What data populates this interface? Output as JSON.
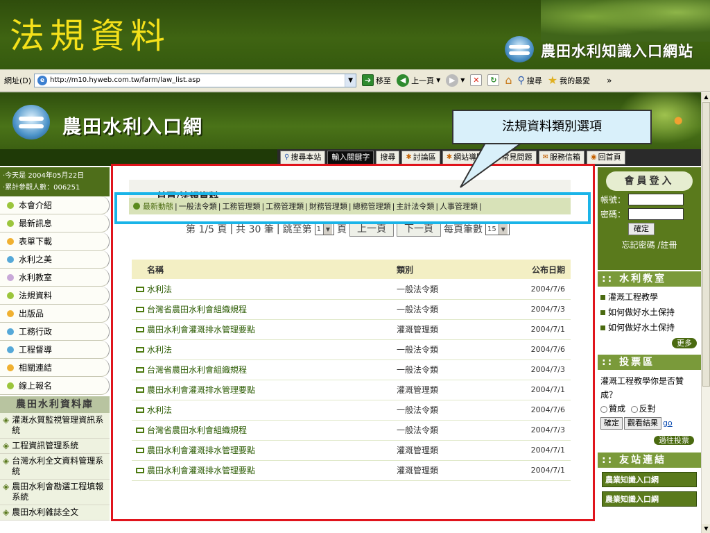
{
  "slide_title": "法規資料",
  "header_brand": "農田水利知識入口網站",
  "address": {
    "label": "網址(D)",
    "url": "http://m10.hyweb.com.tw/farm/law_list.asp",
    "go_label": "移至",
    "back_label": "上一頁",
    "search_label": "搜尋",
    "favorites_label": "我的最愛",
    "more": "»"
  },
  "site": {
    "name": "農田水利入口網"
  },
  "nav": [
    "搜尋本站",
    "輸入關鍵字",
    "搜尋",
    "討論區",
    "網站導覽",
    "常見問題",
    "服務信箱",
    "回首頁"
  ],
  "left": {
    "today": "‧今天是 2004年05月22日",
    "visitors": "‧累計參觀人數：006251",
    "menu": [
      {
        "label": "本會介紹",
        "color": "#9bc53c"
      },
      {
        "label": "最新訊息",
        "color": "#9bc53c"
      },
      {
        "label": "表單下載",
        "color": "#f0b030"
      },
      {
        "label": "水利之美",
        "color": "#55a8d8"
      },
      {
        "label": "水利教室",
        "color": "#c8a8d8"
      },
      {
        "label": "法規資料",
        "color": "#9bc53c"
      },
      {
        "label": "出版品",
        "color": "#f0b030"
      },
      {
        "label": "工務行政",
        "color": "#55a8d8"
      },
      {
        "label": "工程督導",
        "color": "#55a8d8"
      },
      {
        "label": "相關連結",
        "color": "#f0b030"
      },
      {
        "label": "線上報名",
        "color": "#9bc53c"
      }
    ],
    "db_title": "農田水利資料庫",
    "db_items": [
      "灌溉水質監視管理資訊系統",
      "工程資訊管理系統",
      "台灣水利全文資料管理系統",
      "農田水利會勘選工程填報系統",
      "農田水利雜誌全文"
    ]
  },
  "main": {
    "breadcrumb_home": "首頁",
    "breadcrumb_sep": "/",
    "breadcrumb_page": "法規資料",
    "categories": [
      "最新動態",
      "一般法令類",
      "工務管理類",
      "工務管理類",
      "財務管理類",
      "總務管理類",
      "主計法令類",
      "人事管理類"
    ],
    "pager": {
      "text1": "第 1/5 頁",
      "text2": "共 30 筆",
      "text3": "跳至第",
      "page_value": "1",
      "text4": "頁",
      "prev": "上一頁",
      "next": "下一頁",
      "per_page_label": "每頁筆數",
      "per_page_value": "15"
    },
    "table": {
      "headers": [
        "名稱",
        "類別",
        "公布日期"
      ],
      "rows": [
        [
          "水利法",
          "一般法令類",
          "2004/7/6"
        ],
        [
          "台灣省農田水利會組織規程",
          "一般法令類",
          "2004/7/3"
        ],
        [
          "農田水利會灌溉排水管理要點",
          "灌溉管理類",
          "2004/7/1"
        ],
        [
          "水利法",
          "一般法令類",
          "2004/7/6"
        ],
        [
          "台灣省農田水利會組織規程",
          "一般法令類",
          "2004/7/3"
        ],
        [
          "農田水利會灌溉排水管理要點",
          "灌溉管理類",
          "2004/7/1"
        ],
        [
          "水利法",
          "一般法令類",
          "2004/7/6"
        ],
        [
          "台灣省農田水利會組織規程",
          "一般法令類",
          "2004/7/3"
        ],
        [
          "農田水利會灌溉排水管理要點",
          "灌溉管理類",
          "2004/7/1"
        ],
        [
          "農田水利會灌溉排水管理要點",
          "灌溉管理類",
          "2004/7/1"
        ]
      ]
    }
  },
  "right": {
    "login_title": "會員登入",
    "account_label": "帳號：",
    "password_label": "密碼：",
    "confirm": "確定",
    "forgot": "忘記密碼 /註冊",
    "classroom_title": "水利教室",
    "classroom_items": [
      "灌溉工程教學",
      "如何做好水土保持",
      "如何做好水土保持"
    ],
    "more": "更多",
    "vote_title": "投票區",
    "vote_question": "灌溉工程教學你是否贊成？",
    "vote_yes": "贊成",
    "vote_no": "反對",
    "vote_submit": "確定",
    "vote_results": "觀看結果",
    "vote_go": "go",
    "past_votes": "過往投票",
    "friends_title": "友站連結",
    "friend_banner": "農業知識入口網"
  },
  "annotation": "法規資料類別選項"
}
